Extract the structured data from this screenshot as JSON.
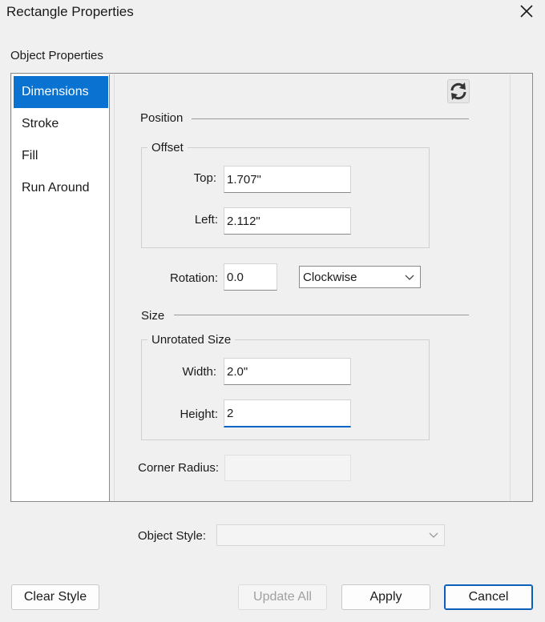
{
  "window": {
    "title": "Rectangle Properties"
  },
  "group_label": "Object Properties",
  "nav": {
    "items": [
      {
        "label": "Dimensions",
        "selected": true
      },
      {
        "label": "Stroke",
        "selected": false
      },
      {
        "label": "Fill",
        "selected": false
      },
      {
        "label": "Run Around",
        "selected": false
      }
    ]
  },
  "icons": {
    "refresh": "refresh-icon",
    "close": "close-icon",
    "dropdown": "chevron-down-icon"
  },
  "position": {
    "title": "Position",
    "offset_title": "Offset",
    "top_label": "Top:",
    "top_value": "1.707\"",
    "left_label": "Left:",
    "left_value": "2.112\"",
    "rotation_label": "Rotation:",
    "rotation_value": "0.0",
    "direction_value": "Clockwise"
  },
  "size": {
    "title": "Size",
    "unrotated_title": "Unrotated Size",
    "width_label": "Width:",
    "width_value": "2.0\"",
    "height_label": "Height:",
    "height_value": "2"
  },
  "corner": {
    "label": "Corner Radius:",
    "value": ""
  },
  "object_style": {
    "label": "Object Style:",
    "value": ""
  },
  "buttons": {
    "clear_style": "Clear Style",
    "update_all": "Update All",
    "apply": "Apply",
    "cancel": "Cancel"
  },
  "colors": {
    "selection": "#0a72d1",
    "focus": "#0063c7",
    "default_button_border": "#0a5fb8"
  }
}
